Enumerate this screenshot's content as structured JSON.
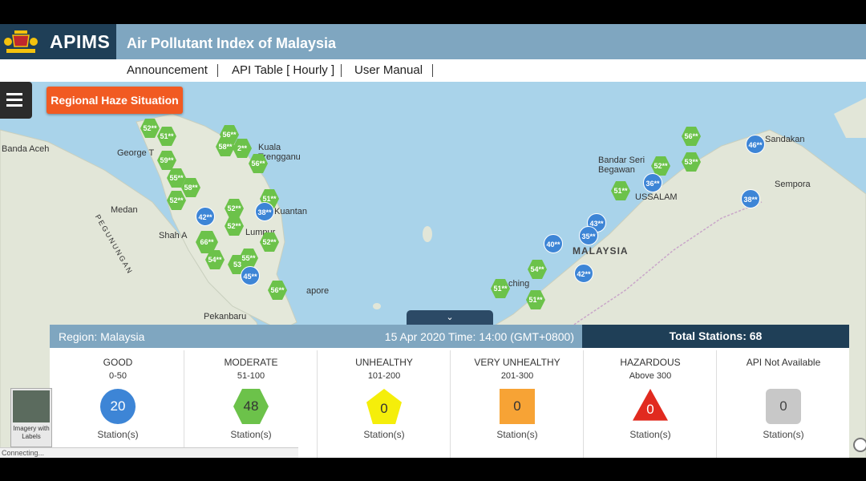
{
  "header": {
    "brand": "APIMS",
    "title": "Air Pollutant Index of Malaysia"
  },
  "nav": {
    "items": [
      "Announcement",
      "API Table [ Hourly ]",
      "User Manual"
    ]
  },
  "map": {
    "haze_button": "Regional Haze Situation",
    "places": [
      "Banda Aceh",
      "George T",
      "Medan",
      "Shah A",
      "Kuala Trengganu",
      "Kuantan",
      "Lumpur",
      "Pekanbaru",
      "apore",
      "Bandar Seri Begawan",
      "USSALAM",
      "ching",
      "MALAYSIA",
      "Sandakan",
      "Sempora",
      "PEGUNUNGAN"
    ],
    "markers": [
      {
        "v": "52**",
        "t": "hex"
      },
      {
        "v": "51**",
        "t": "hex"
      },
      {
        "v": "59**",
        "t": "hex"
      },
      {
        "v": "55**",
        "t": "hex"
      },
      {
        "v": "58**",
        "t": "hex"
      },
      {
        "v": "52**",
        "t": "hex"
      },
      {
        "v": "56**",
        "t": "hex"
      },
      {
        "v": "58**",
        "t": "hex"
      },
      {
        "v": "2**",
        "t": "hex"
      },
      {
        "v": "56**",
        "t": "hex"
      },
      {
        "v": "51**",
        "t": "hex"
      },
      {
        "v": "38**",
        "t": "circ"
      },
      {
        "v": "42**",
        "t": "circ"
      },
      {
        "v": "52**",
        "t": "hex"
      },
      {
        "v": "52**",
        "t": "hex"
      },
      {
        "v": "66**",
        "t": "hex"
      },
      {
        "v": "54**",
        "t": "hex"
      },
      {
        "v": "53",
        "t": "hex"
      },
      {
        "v": "55**",
        "t": "hex"
      },
      {
        "v": "45**",
        "t": "circ"
      },
      {
        "v": "52**",
        "t": "hex"
      },
      {
        "v": "56**",
        "t": "hex"
      },
      {
        "v": "56**",
        "t": "hex"
      },
      {
        "v": "52**",
        "t": "hex"
      },
      {
        "v": "53**",
        "t": "hex"
      },
      {
        "v": "51**",
        "t": "hex"
      },
      {
        "v": "36**",
        "t": "circ"
      },
      {
        "v": "46**",
        "t": "circ"
      },
      {
        "v": "38**",
        "t": "circ"
      },
      {
        "v": "43**",
        "t": "circ"
      },
      {
        "v": "35**",
        "t": "circ"
      },
      {
        "v": "40**",
        "t": "circ"
      },
      {
        "v": "42**",
        "t": "circ"
      },
      {
        "v": "54**",
        "t": "hex"
      },
      {
        "v": "51**",
        "t": "hex"
      },
      {
        "v": "51**",
        "t": "hex"
      }
    ],
    "imagery_label": "Imagery with Labels",
    "status": "Connecting..."
  },
  "panel": {
    "region": "Region: Malaysia",
    "datetime": "15 Apr 2020   Time: 14:00 (GMT+0800)",
    "total": "Total Stations: 68",
    "categories": [
      {
        "name": "GOOD",
        "range": "0-50",
        "count": "20",
        "label": "Station(s)",
        "color": "#3d85d6",
        "shape": "circle"
      },
      {
        "name": "MODERATE",
        "range": "51-100",
        "count": "48",
        "label": "Station(s)",
        "color": "#6cc24a",
        "shape": "hexagon"
      },
      {
        "name": "UNHEALTHY",
        "range": "101-200",
        "count": "0",
        "label": "Station(s)",
        "color": "#f5ee0a",
        "shape": "pentagon"
      },
      {
        "name": "VERY UNHEALTHY",
        "range": "201-300",
        "count": "0",
        "label": "Station(s)",
        "color": "#f7a335",
        "shape": "square"
      },
      {
        "name": "HAZARDOUS",
        "range": "Above 300",
        "count": "0",
        "label": "Station(s)",
        "color": "#e12a1f",
        "shape": "triangle"
      },
      {
        "name": "API Not Available",
        "range": "",
        "count": "0",
        "label": "Station(s)",
        "color": "#c8c8c8",
        "shape": "rounded-square"
      }
    ]
  }
}
